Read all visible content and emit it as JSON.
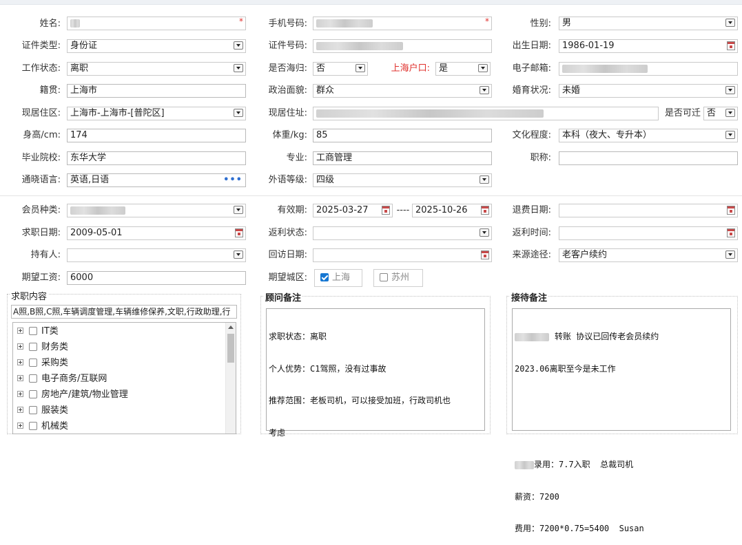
{
  "form": {
    "name": {
      "label": "姓名:",
      "value": "",
      "required": "*"
    },
    "mobile": {
      "label": "手机号码:",
      "value": "",
      "required": "*"
    },
    "gender": {
      "label": "性别:",
      "value": "男"
    },
    "id_type": {
      "label": "证件类型:",
      "value": "身份证"
    },
    "id_number": {
      "label": "证件号码:",
      "value": ""
    },
    "birth_date": {
      "label": "出生日期:",
      "value": "1986-01-19"
    },
    "work_status": {
      "label": "工作状态:",
      "value": "离职"
    },
    "returnee": {
      "label": "是否海归:",
      "value": "否"
    },
    "sh_hukou": {
      "label": "上海户口:",
      "value": "是"
    },
    "email": {
      "label": "电子邮箱:",
      "value": ""
    },
    "native_place": {
      "label": "籍贯:",
      "value": "上海市"
    },
    "political": {
      "label": "政治面貌:",
      "value": "群众"
    },
    "marital": {
      "label": "婚育状况:",
      "value": "未婚"
    },
    "current_area": {
      "label": "现居住区:",
      "value": " 上海市-上海市-[普陀区]"
    },
    "current_address": {
      "label": "现居住址:",
      "value": ""
    },
    "relocate": {
      "label": "是否可迁",
      "value": "否"
    },
    "height": {
      "label": "身高/cm:",
      "value": "174"
    },
    "weight": {
      "label": "体重/kg:",
      "value": "85"
    },
    "education": {
      "label": "文化程度:",
      "value": "本科（夜大、专升本）"
    },
    "school": {
      "label": "毕业院校:",
      "value": "东华大学"
    },
    "major": {
      "label": "专业:",
      "value": "工商管理"
    },
    "title": {
      "label": "职称:",
      "value": ""
    },
    "languages": {
      "label": "通晓语言:",
      "value": "英语,日语",
      "more": "•••"
    },
    "foreign_level": {
      "label": "外语等级:",
      "value": "四级"
    },
    "member_type": {
      "label": "会员种类:",
      "value": ""
    },
    "validity": {
      "label": "有效期:",
      "from": "2025-03-27",
      "sep": "----",
      "to": "2025-10-26"
    },
    "refund_date": {
      "label": "退费日期:",
      "value": ""
    },
    "job_date": {
      "label": "求职日期:",
      "value": "2009-05-01"
    },
    "rebate_status": {
      "label": "返利状态:",
      "value": ""
    },
    "rebate_time": {
      "label": "返利时间:",
      "value": ""
    },
    "holder": {
      "label": "持有人:",
      "value": ""
    },
    "visit_date": {
      "label": "回访日期:",
      "value": ""
    },
    "source": {
      "label": "来源途径:",
      "value": "老客户续约"
    },
    "expected_salary": {
      "label": "期望工资:",
      "value": "6000"
    },
    "expected_city": {
      "label": "期望城区:",
      "options": [
        {
          "label": "上海",
          "checked": true
        },
        {
          "label": "苏州",
          "checked": false
        }
      ]
    }
  },
  "job_content": {
    "title": "求职内容",
    "summary": "A照,B照,C照,车辆调度管理,车辆维修保养,文职,行政助理,行",
    "categories": [
      "IT类",
      "财务类",
      "采购类",
      "电子商务/互联网",
      "房地产/建筑/物业管理",
      "服装类",
      "机械类"
    ]
  },
  "advisor_note": {
    "title": "顾问备注",
    "lines": [
      "求职状态：离职",
      "个人优势：C1驾照，没有过事故",
      "推荐范围：老板司机，可以接受加班，行政司机也",
      "考虑"
    ]
  },
  "reception_note": {
    "title": "接待备注",
    "lines": [
      "转账 协议已回传老会员续约",
      "2023.06离职至今是未工作",
      "",
      "",
      "录用：7.7入职  总裁司机",
      "薪资：7200",
      "费用：7200*0.75=5400  Susan"
    ]
  },
  "colors": {
    "accent": "#1677d2",
    "required": "#e0302c",
    "border": "#c9c9c9"
  }
}
